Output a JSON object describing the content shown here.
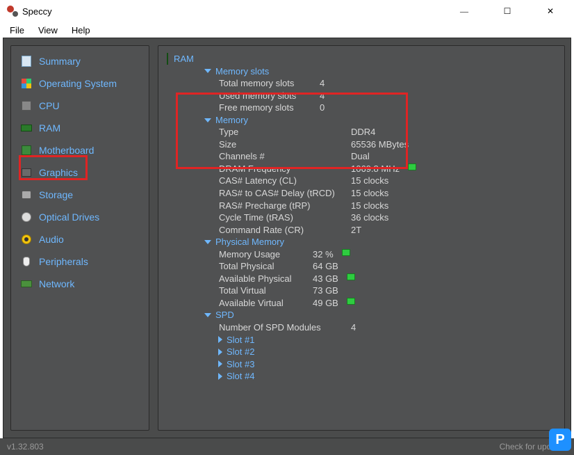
{
  "app": {
    "title": "Speccy"
  },
  "window_controls": {
    "minimize": "—",
    "maximize": "☐",
    "close": "✕"
  },
  "menu": [
    "File",
    "View",
    "Help"
  ],
  "sidebar": {
    "items": [
      {
        "label": "Summary"
      },
      {
        "label": "Operating System"
      },
      {
        "label": "CPU"
      },
      {
        "label": "RAM"
      },
      {
        "label": "Motherboard"
      },
      {
        "label": "Graphics"
      },
      {
        "label": "Storage"
      },
      {
        "label": "Optical Drives"
      },
      {
        "label": "Audio"
      },
      {
        "label": "Peripherals"
      },
      {
        "label": "Network"
      }
    ]
  },
  "content": {
    "title": "RAM",
    "memory_slots": {
      "header": "Memory slots",
      "rows": [
        {
          "k": "Total memory slots",
          "v": "4"
        },
        {
          "k": "Used memory slots",
          "v": "4"
        },
        {
          "k": "Free memory slots",
          "v": "0"
        }
      ]
    },
    "memory": {
      "header": "Memory",
      "rows": [
        {
          "k": "Type",
          "v": "DDR4"
        },
        {
          "k": "Size",
          "v": "65536 MBytes"
        },
        {
          "k": "Channels #",
          "v": "Dual"
        },
        {
          "k": "DRAM Frequency",
          "v": "1069.8 MHz",
          "indicator": true
        },
        {
          "k": "CAS# Latency (CL)",
          "v": "15 clocks"
        },
        {
          "k": "RAS# to CAS# Delay (tRCD)",
          "v": "15 clocks"
        },
        {
          "k": "RAS# Precharge (tRP)",
          "v": "15 clocks"
        },
        {
          "k": "Cycle Time (tRAS)",
          "v": "36 clocks"
        },
        {
          "k": "Command Rate (CR)",
          "v": "2T"
        }
      ]
    },
    "physical_memory": {
      "header": "Physical Memory",
      "rows": [
        {
          "k": "Memory Usage",
          "v": "32 %",
          "indicator": true
        },
        {
          "k": "Total Physical",
          "v": "64 GB"
        },
        {
          "k": "Available Physical",
          "v": "43 GB",
          "indicator": true
        },
        {
          "k": "Total Virtual",
          "v": "73 GB"
        },
        {
          "k": "Available Virtual",
          "v": "49 GB",
          "indicator": true
        }
      ]
    },
    "spd": {
      "header": "SPD",
      "num_modules_label": "Number Of SPD Modules",
      "num_modules_value": "4",
      "slots": [
        "Slot #1",
        "Slot #2",
        "Slot #3",
        "Slot #4"
      ]
    }
  },
  "status": {
    "version": "v1.32.803",
    "update_text": "Check for updates"
  }
}
